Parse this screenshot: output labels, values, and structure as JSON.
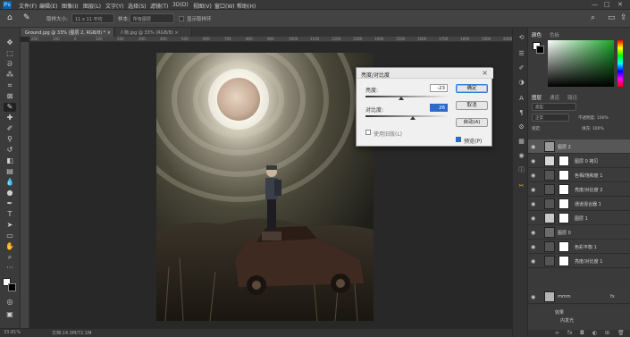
{
  "menu": {
    "logo": "Ps",
    "items": [
      "文件(F)",
      "编辑(E)",
      "图像(I)",
      "图层(L)",
      "文字(Y)",
      "选择(S)",
      "滤镜(T)",
      "3D(D)",
      "视图(V)",
      "窗口(W)",
      "帮助(H)"
    ],
    "window_controls": [
      "—",
      "□",
      "✕"
    ]
  },
  "options": {
    "brush_size_label": "取样大小:",
    "brush_size_value": "11 x 11 平均",
    "sample_label": "样本:",
    "sample_value": "所有图层",
    "ring_value": "显示取样环"
  },
  "tabs": [
    {
      "label": "Ground.jpg @ 33% (图层 2, RGB/8) * ×",
      "active": true
    },
    {
      "label": "人物.jpg @ 33% (RGB/8) ×",
      "active": false
    }
  ],
  "ruler": {
    "top": [
      "200",
      "100",
      "0",
      "100",
      "200",
      "300",
      "400",
      "500",
      "600",
      "700",
      "800",
      "900",
      "1000",
      "1100",
      "1200",
      "1300",
      "1400",
      "1500",
      "1600",
      "1700",
      "1800",
      "1900",
      "2000"
    ]
  },
  "tools": [
    "move-tool",
    "marquee-tool",
    "lasso-tool",
    "magic-wand-tool",
    "crop-tool",
    "frame-tool",
    "eyedropper-tool",
    "healing-tool",
    "brush-tool",
    "stamp-tool",
    "history-brush-tool",
    "eraser-tool",
    "gradient-tool",
    "blur-tool",
    "dodge-tool",
    "pen-tool",
    "type-tool",
    "path-select-tool",
    "shape-tool",
    "hand-tool",
    "zoom-tool",
    "more-tool"
  ],
  "status": {
    "zoom": "33.81%",
    "doc": "文档:14.3M/72.1M"
  },
  "dialog": {
    "title": "亮度/对比度",
    "brightness_label": "亮度:",
    "brightness_value": "-23",
    "contrast_label": "对比度:",
    "contrast_value": "26",
    "brightness_level": 0.44,
    "contrast_level": 0.58,
    "ok": "确定",
    "cancel": "取消",
    "auto": "自动(A)",
    "legacy": "使用旧版(L)",
    "preview": "预览(P)"
  },
  "color_panel": {
    "tabs": [
      "颜色",
      "色板"
    ]
  },
  "layers_panel": {
    "tabs": [
      "图层",
      "通道",
      "路径"
    ],
    "kind_label": "类型",
    "blend_mode": "正常",
    "opacity_label": "不透明度: 100%",
    "lock_label": "锁定:",
    "fill_label": "填充: 100%",
    "layers": [
      {
        "name": "图层 2",
        "selected": true,
        "thumb": "#9a9a9a",
        "mask": false
      },
      {
        "name": "图层 0 拷贝",
        "selected": false,
        "thumb": "#d8d8d8",
        "mask": true
      },
      {
        "name": "色相/饱和度 1",
        "selected": false,
        "thumb": "#555",
        "mask": true
      },
      {
        "name": "亮度/对比度 2",
        "selected": false,
        "thumb": "#555",
        "mask": true
      },
      {
        "name": "通道混合器 1",
        "selected": false,
        "thumb": "#555",
        "mask": true
      },
      {
        "name": "图层 1",
        "selected": false,
        "thumb": "#c9c9c9",
        "mask": true
      },
      {
        "name": "图层 0",
        "selected": false,
        "thumb": "#6c6c6c",
        "mask": false
      },
      {
        "name": "色彩平衡 1",
        "selected": false,
        "thumb": "#555",
        "mask": true
      },
      {
        "name": "亮度/对比度 1",
        "selected": false,
        "thumb": "#555",
        "mask": true
      },
      {
        "name": "mmm",
        "selected": false,
        "thumb": "#b5b5b5",
        "mask": false
      }
    ],
    "effects_label": "效果",
    "inner_glow": "内发光"
  },
  "colors": {
    "accent": "#2d6ac9",
    "panel_bg": "#3a3a3a",
    "canvas_bg": "#282828"
  }
}
